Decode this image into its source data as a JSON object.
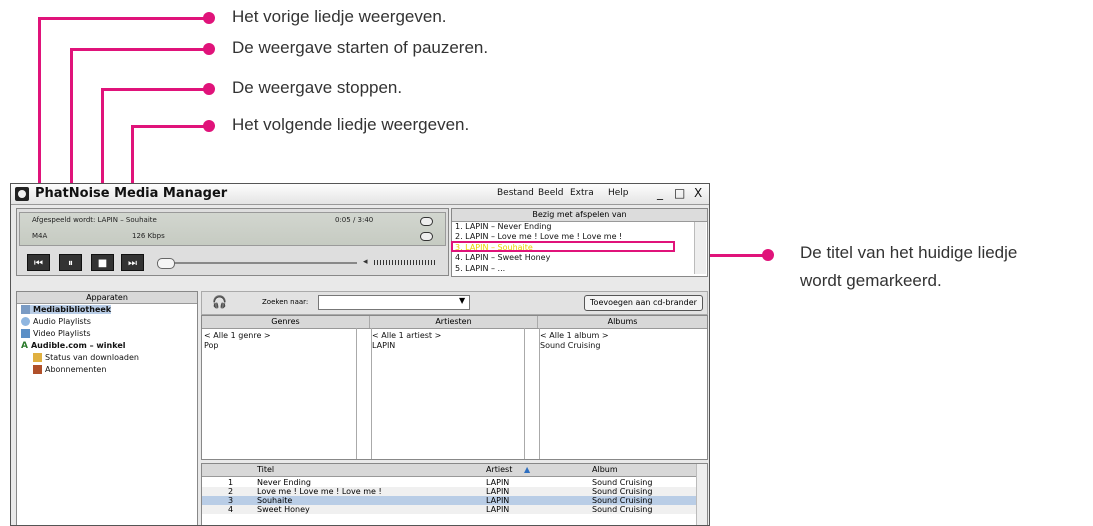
{
  "annotations": {
    "prev": "Het vorige liedje weergeven.",
    "playpause": "De weergave starten of pauzeren.",
    "stop": "De weergave stoppen.",
    "next": "Het volgende liedje weergeven.",
    "highlight_line1": "De titel van het huidige liedje",
    "highlight_line2": "wordt gemarkeerd."
  },
  "app": {
    "title": "PhatNoise Media Manager",
    "menu": [
      "Bestand",
      "Beeld",
      "Extra",
      "Help"
    ],
    "window_controls": {
      "minimize": "_",
      "maximize": "□",
      "close": "X"
    }
  },
  "player": {
    "now_playing_label": "Afgespeeld wordt: LAPIN – Souhaite",
    "time": "0:05 / 3:40",
    "format": "M4A",
    "bitrate": "126 Kbps",
    "buttons": {
      "prev": "⏮",
      "pause": "⏸",
      "stop": "■",
      "next": "⏭"
    }
  },
  "now_playing_list": {
    "header": "Bezig met afspelen van",
    "items": [
      "1. LAPIN – Never Ending",
      "2. LAPIN – Love me ! Love me ! Love me !",
      "3. LAPIN – Souhaite",
      "4. LAPIN – Sweet Honey",
      "5. LAPIN – ..."
    ],
    "current_index": 2
  },
  "devices": {
    "header": "Apparaten",
    "items": [
      {
        "label": "Mediabibliotheek",
        "bold": true,
        "selected": true
      },
      {
        "label": "Audio Playlists",
        "bold": false
      },
      {
        "label": "Video Playlists",
        "bold": false
      },
      {
        "label": "Audible.com – winkel",
        "bold": true
      },
      {
        "label": "Status van downloaden",
        "bold": false
      },
      {
        "label": "Abonnementen",
        "bold": false
      }
    ]
  },
  "search": {
    "label": "Zoeken naar:",
    "value": "",
    "burn_button": "Toevoegen aan cd-brander"
  },
  "browser": {
    "genres": {
      "header": "Genres",
      "items": [
        "< Alle 1 genre >",
        "Pop"
      ]
    },
    "artists": {
      "header": "Artiesten",
      "items": [
        "< Alle 1 artiest >",
        "LAPIN"
      ]
    },
    "albums": {
      "header": "Albums",
      "items": [
        "< Alle 1 album >",
        "Sound Cruising"
      ]
    }
  },
  "tracks": {
    "columns": {
      "num": "",
      "title": "Titel",
      "artist": "Artiest",
      "album": "Album"
    },
    "sort_indicator": "▲",
    "rows": [
      {
        "num": "1",
        "title": "Never Ending",
        "artist": "LAPIN",
        "album": "Sound Cruising"
      },
      {
        "num": "2",
        "title": "Love me ! Love me ! Love me !",
        "artist": "LAPIN",
        "album": "Sound Cruising"
      },
      {
        "num": "3",
        "title": "Souhaite",
        "artist": "LAPIN",
        "album": "Sound Cruising"
      },
      {
        "num": "4",
        "title": "Sweet Honey",
        "artist": "LAPIN",
        "album": "Sound Cruising"
      }
    ],
    "selected_index": 2
  },
  "colors": {
    "accent": "#e0137a",
    "current_track": "#e8d000",
    "selection": "#b9cde6"
  }
}
